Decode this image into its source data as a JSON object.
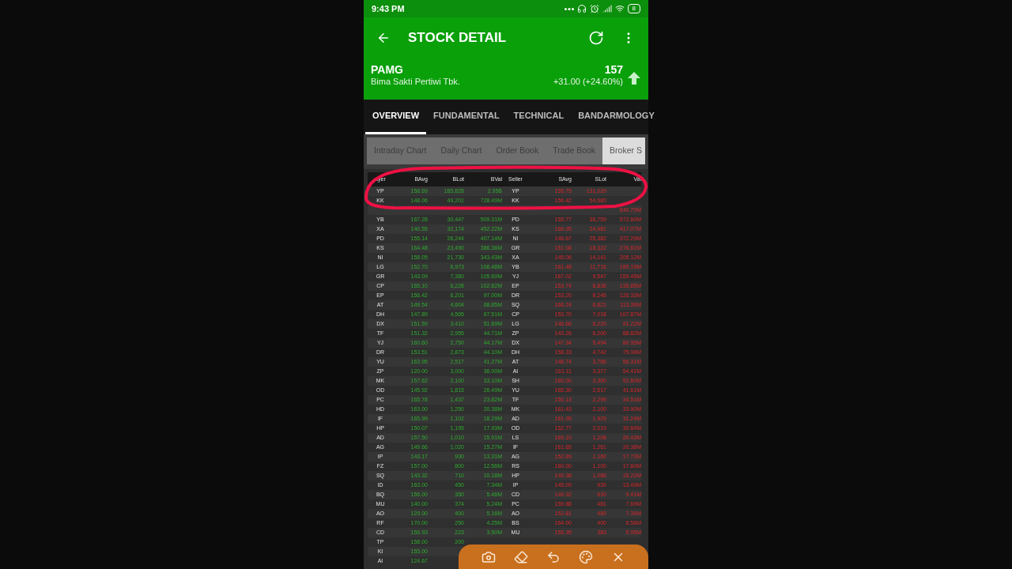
{
  "status_bar": {
    "time": "9:43 PM",
    "battery": "8"
  },
  "header": {
    "title": "STOCK DETAIL",
    "symbol": "PAMG",
    "company": "Bima Sakti Pertiwi Tbk.",
    "price": "157",
    "change": "+31.00 (+24.60%)"
  },
  "tabs": [
    {
      "label": "OVERVIEW",
      "selected": true
    },
    {
      "label": "FUNDAMENTAL",
      "selected": false
    },
    {
      "label": "TECHNICAL",
      "selected": false
    },
    {
      "label": "BANDARMOLOGY",
      "selected": false
    }
  ],
  "sub_tabs": [
    {
      "label": "Intraday Chart",
      "selected": false
    },
    {
      "label": "Daily Chart",
      "selected": false
    },
    {
      "label": "Order Book",
      "selected": false
    },
    {
      "label": "Trade Book",
      "selected": false
    },
    {
      "label": "Broker S",
      "selected": true
    }
  ],
  "table": {
    "columns": [
      "uyer",
      "BAvg",
      "BLot",
      "BVal",
      "Seller",
      "SAvg",
      "SLot",
      "Val"
    ],
    "rows": [
      {
        "buyer": "YP",
        "bavg": "158.69",
        "blot": "185,828",
        "bval": "2.95B",
        "seller": "YP",
        "savg": "155.75",
        "slot": "131,029"
      },
      {
        "buyer": "KK",
        "bavg": "148.06",
        "blot": "49,201",
        "bval": "728.49M",
        "seller": "KK",
        "savg": "156.42",
        "slot": "54,680"
      },
      {
        "sval": "840.79M"
      },
      {
        "buyer": "YB",
        "bavg": "167.28",
        "blot": "30,447",
        "bval": "509.31M",
        "seller": "PD",
        "savg": "155.77",
        "slot": "36,759",
        "sval": "572.60M"
      },
      {
        "buyer": "XA",
        "bavg": "140.55",
        "blot": "32,174",
        "bval": "452.22M",
        "seller": "KS",
        "savg": "166.95",
        "slot": "24,981",
        "sval": "417.07M"
      },
      {
        "buyer": "PD",
        "bavg": "155.14",
        "blot": "26,244",
        "bval": "407.14M",
        "seller": "NI",
        "savg": "146.67",
        "slot": "25,382",
        "sval": "372.29M"
      },
      {
        "buyer": "KS",
        "bavg": "164.48",
        "blot": "23,490",
        "bval": "386.36M",
        "seller": "GR",
        "savg": "151.08",
        "slot": "18,322",
        "sval": "276.81M"
      },
      {
        "buyer": "NI",
        "bavg": "158.05",
        "blot": "21,730",
        "bval": "343.43M",
        "seller": "XA",
        "savg": "145.06",
        "slot": "14,141",
        "sval": "205.12M"
      },
      {
        "buyer": "LG",
        "bavg": "152.70",
        "blot": "6,973",
        "bval": "106.48M",
        "seller": "YB",
        "savg": "161.48",
        "slot": "11,716",
        "sval": "189.19M"
      },
      {
        "buyer": "GR",
        "bavg": "143.09",
        "blot": "7,380",
        "bval": "105.60M",
        "seller": "YJ",
        "savg": "167.02",
        "slot": "9,547",
        "sval": "159.45M"
      },
      {
        "buyer": "CP",
        "bavg": "165.10",
        "blot": "6,228",
        "bval": "102.82M",
        "seller": "EP",
        "savg": "153.74",
        "slot": "8,836",
        "sval": "135.85M"
      },
      {
        "buyer": "EP",
        "bavg": "156.42",
        "blot": "6,201",
        "bval": "97.00M",
        "seller": "DR",
        "savg": "153.20",
        "slot": "8,246",
        "sval": "126.33M"
      },
      {
        "buyer": "AT",
        "bavg": "149.54",
        "blot": "4,604",
        "bval": "68.85M",
        "seller": "SQ",
        "savg": "166.24",
        "slot": "6,821",
        "sval": "113.39M"
      },
      {
        "buyer": "DH",
        "bavg": "147.89",
        "blot": "4,565",
        "bval": "67.51M",
        "seller": "CP",
        "savg": "153.70",
        "slot": "7,018",
        "sval": "107.87M"
      },
      {
        "buyer": "DX",
        "bavg": "151.59",
        "blot": "3,410",
        "bval": "51.69M",
        "seller": "LG",
        "savg": "146.66",
        "slot": "6,220",
        "sval": "91.22M"
      },
      {
        "buyer": "TF",
        "bavg": "151.32",
        "blot": "2,955",
        "bval": "44.71M",
        "seller": "ZP",
        "savg": "143.26",
        "slot": "6,200",
        "sval": "88.82M"
      },
      {
        "buyer": "YJ",
        "bavg": "160.60",
        "blot": "2,750",
        "bval": "44.17M",
        "seller": "DX",
        "savg": "147.34",
        "slot": "5,494",
        "sval": "80.95M"
      },
      {
        "buyer": "DR",
        "bavg": "153.51",
        "blot": "2,873",
        "bval": "44.10M",
        "seller": "DH",
        "savg": "158.33",
        "slot": "4,742",
        "sval": "75.08M"
      },
      {
        "buyer": "YU",
        "bavg": "163.95",
        "blot": "2,517",
        "bval": "41.27M",
        "seller": "AT",
        "savg": "148.74",
        "slot": "3,786",
        "sval": "56.31M"
      },
      {
        "buyer": "ZP",
        "bavg": "120.00",
        "blot": "3,000",
        "bval": "36.00M",
        "seller": "AI",
        "savg": "161.11",
        "slot": "3,377",
        "sval": "54.41M"
      },
      {
        "buyer": "MK",
        "bavg": "157.62",
        "blot": "2,100",
        "bval": "33.10M",
        "seller": "SH",
        "savg": "160.00",
        "slot": "3,300",
        "sval": "52.80M"
      },
      {
        "buyer": "OD",
        "bavg": "145.92",
        "blot": "1,815",
        "bval": "26.49M",
        "seller": "YU",
        "savg": "165.30",
        "slot": "2,517",
        "sval": "41.61M"
      },
      {
        "buyer": "PC",
        "bavg": "165.78",
        "blot": "1,437",
        "bval": "23.82M",
        "seller": "TF",
        "savg": "150.13",
        "slot": "2,299",
        "sval": "34.51M"
      },
      {
        "buyer": "HD",
        "bavg": "163.00",
        "blot": "1,250",
        "bval": "20.38M",
        "seller": "MK",
        "savg": "161.43",
        "slot": "2,100",
        "sval": "33.90M"
      },
      {
        "buyer": "IF",
        "bavg": "165.99",
        "blot": "1,102",
        "bval": "18.29M",
        "seller": "AD",
        "savg": "161.95",
        "slot": "1,929",
        "sval": "31.24M"
      },
      {
        "buyer": "HP",
        "bavg": "150.07",
        "blot": "1,195",
        "bval": "17.93M",
        "seller": "OD",
        "savg": "152.77",
        "slot": "2,019",
        "sval": "30.84M"
      },
      {
        "buyer": "AD",
        "bavg": "157.50",
        "blot": "1,010",
        "bval": "15.91M",
        "seller": "LS",
        "savg": "169.10",
        "slot": "1,208",
        "sval": "20.43M"
      },
      {
        "buyer": "AG",
        "bavg": "149.66",
        "blot": "1,020",
        "bval": "15.27M",
        "seller": "IF",
        "savg": "161.65",
        "slot": "1,261",
        "sval": "20.38M"
      },
      {
        "buyer": "IP",
        "bavg": "143.17",
        "blot": "930",
        "bval": "13.31M",
        "seller": "AG",
        "savg": "152.89",
        "slot": "1,160",
        "sval": "17.73M"
      },
      {
        "buyer": "FZ",
        "bavg": "157.00",
        "blot": "800",
        "bval": "12.56M",
        "seller": "RS",
        "savg": "160.00",
        "slot": "1,100",
        "sval": "17.60M"
      },
      {
        "buyer": "SQ",
        "bavg": "143.32",
        "blot": "710",
        "bval": "10.18M",
        "seller": "HP",
        "savg": "149.38",
        "slot": "1,086",
        "sval": "16.22M"
      },
      {
        "buyer": "ID",
        "bavg": "163.00",
        "blot": "450",
        "bval": "7.34M",
        "seller": "IP",
        "savg": "145.09",
        "slot": "930",
        "sval": "13.49M"
      },
      {
        "buyer": "BQ",
        "bavg": "156.00",
        "blot": "350",
        "bval": "5.46M",
        "seller": "CD",
        "savg": "149.32",
        "slot": "630",
        "sval": "9.41M"
      },
      {
        "buyer": "MU",
        "bavg": "140.00",
        "blot": "374",
        "bval": "5.24M",
        "seller": "PC",
        "savg": "159.88",
        "slot": "481",
        "sval": "7.69M"
      },
      {
        "buyer": "AO",
        "bavg": "129.00",
        "blot": "400",
        "bval": "5.16M",
        "seller": "AO",
        "savg": "152.81",
        "slot": "480",
        "sval": "7.34M"
      },
      {
        "buyer": "RF",
        "bavg": "170.00",
        "blot": "250",
        "bval": "4.25M",
        "seller": "BS",
        "savg": "164.00",
        "slot": "400",
        "sval": "6.56M"
      },
      {
        "buyer": "CD",
        "bavg": "156.93",
        "blot": "223",
        "bval": "3.50M",
        "seller": "MU",
        "savg": "155.35",
        "slot": "383",
        "sval": "5.95M"
      },
      {
        "buyer": "TP",
        "bavg": "158.00",
        "blot": "200"
      },
      {
        "buyer": "KI",
        "bavg": "155.00"
      },
      {
        "buyer": "AI",
        "bavg": "124.67"
      }
    ]
  }
}
